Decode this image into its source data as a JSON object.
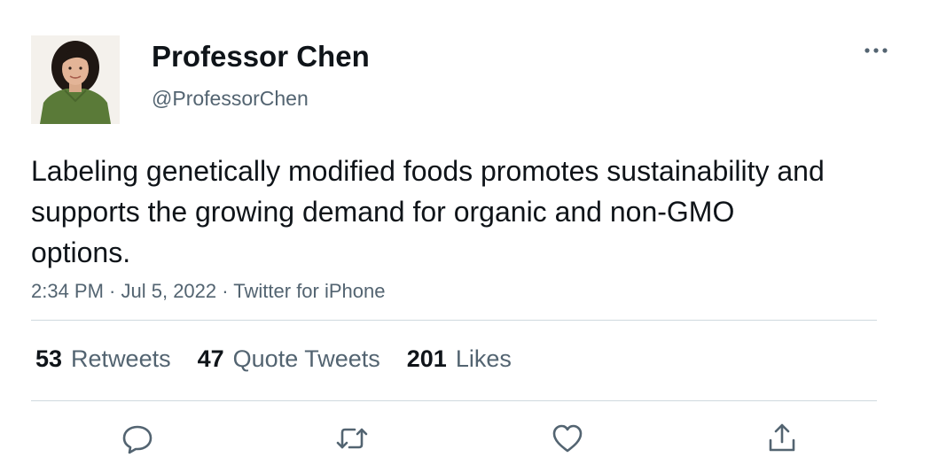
{
  "author": {
    "name": "Professor Chen",
    "handle": "@ProfessorChen",
    "avatar_icon": "user-photo-avatar"
  },
  "tweet": {
    "text": "Labeling genetically modified foods promotes sustainability and supports the growing demand for organic and non-GMO options.",
    "time": "2:34 PM",
    "sep1": " · ",
    "date": "Jul 5, 2022",
    "sep2": " · ",
    "source": "Twitter for iPhone"
  },
  "stats": {
    "retweets_count": "53",
    "retweets_label": "Retweets",
    "quotes_count": "47",
    "quotes_label": "Quote Tweets",
    "likes_count": "201",
    "likes_label": "Likes"
  },
  "icons": {
    "more": "more-horizontal-icon",
    "reply": "reply-icon",
    "retweet": "retweet-icon",
    "like": "heart-icon",
    "share": "share-icon"
  },
  "colors": {
    "text_primary": "#0f1419",
    "text_secondary": "#536471",
    "divider": "#cfd9de"
  }
}
